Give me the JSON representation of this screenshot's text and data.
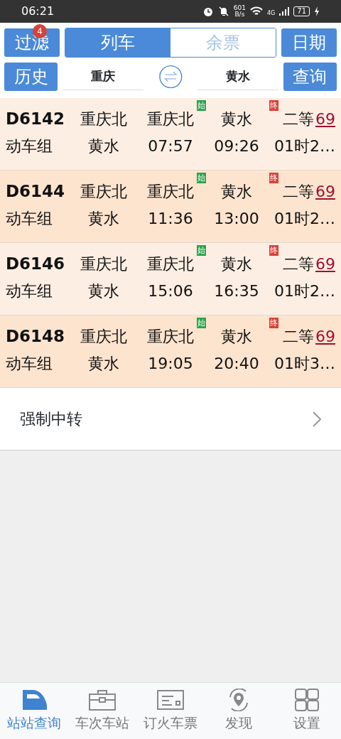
{
  "status_bar": {
    "time": "06:21",
    "speed_value": "601",
    "speed_unit": "B/s",
    "network": "4G",
    "battery": "71"
  },
  "toolbar": {
    "filter": {
      "label": "过滤",
      "badge": "4"
    },
    "tabs": [
      {
        "label": "列车",
        "selected": true
      },
      {
        "label": "余票",
        "selected": false
      }
    ],
    "date_button": "日期"
  },
  "search": {
    "history_button": "历史",
    "from": "重庆",
    "to": "黄水",
    "query_button": "查询"
  },
  "trains": [
    {
      "number": "D6142",
      "type": "动车组",
      "from_station": "重庆北",
      "to_station": "黄水",
      "depart_station": "重庆北",
      "start_tag": "始",
      "arrive_station": "黄水",
      "end_tag": "终",
      "depart_time": "07:57",
      "arrive_time": "09:26",
      "seat_class": "二等",
      "seat_count": "69",
      "duration": "01时2…"
    },
    {
      "number": "D6144",
      "type": "动车组",
      "from_station": "重庆北",
      "to_station": "黄水",
      "depart_station": "重庆北",
      "start_tag": "始",
      "arrive_station": "黄水",
      "end_tag": "终",
      "depart_time": "11:36",
      "arrive_time": "13:00",
      "seat_class": "二等",
      "seat_count": "69",
      "duration": "01时2…"
    },
    {
      "number": "D6146",
      "type": "动车组",
      "from_station": "重庆北",
      "to_station": "黄水",
      "depart_station": "重庆北",
      "start_tag": "始",
      "arrive_station": "黄水",
      "end_tag": "终",
      "depart_time": "15:06",
      "arrive_time": "16:35",
      "seat_class": "二等",
      "seat_count": "69",
      "duration": "01时2…"
    },
    {
      "number": "D6148",
      "type": "动车组",
      "from_station": "重庆北",
      "to_station": "黄水",
      "depart_station": "重庆北",
      "start_tag": "始",
      "arrive_station": "黄水",
      "end_tag": "终",
      "depart_time": "19:05",
      "arrive_time": "20:40",
      "seat_class": "二等",
      "seat_count": "69",
      "duration": "01时3…"
    }
  ],
  "transfer_row": {
    "label": "强制中转"
  },
  "bottom_nav": [
    {
      "label": "站站查询",
      "selected": true
    },
    {
      "label": "车次车站",
      "selected": false
    },
    {
      "label": "订火车票",
      "selected": false
    },
    {
      "label": "发现",
      "selected": false
    },
    {
      "label": "设置",
      "selected": false
    }
  ]
}
